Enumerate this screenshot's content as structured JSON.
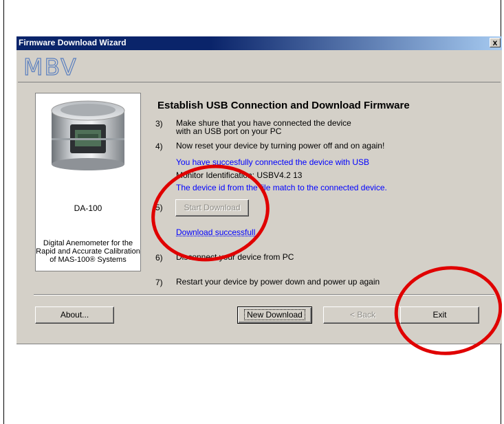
{
  "window": {
    "title": "Firmware Download Wizard",
    "close_label": "x",
    "logo_text": "MBV"
  },
  "device": {
    "name": "DA-100",
    "description": "Digital Anemometer for the Rapid and Accurate Calibration of MAS-100® Systems"
  },
  "heading": "Establish USB Connection and Download Firmware",
  "steps": [
    {
      "num": "3)",
      "line1": "Make shure that you have connected the device",
      "line2": "with an USB port on your PC"
    },
    {
      "num": "4)",
      "line1": "Now reset your device by turning power off and on again!"
    },
    {
      "num": "5)"
    },
    {
      "num": "6)",
      "line1": "Disconnect your device from PC"
    },
    {
      "num": "7)",
      "line1": "Restart your device by power down  and  power up again"
    }
  ],
  "status": {
    "connected": "You have succesfully connected the device with USB",
    "monitor_id": "Monitor Identification: USBV4.2 13",
    "id_match": "The device id from the file match to the connected device.",
    "download_result": "Download successfull"
  },
  "buttons": {
    "start_download": "Start Download",
    "about": "About...",
    "new_download": "New Download",
    "back": "< Back",
    "exit": "Exit"
  },
  "colors": {
    "status_text": "#0000ff",
    "annotation": "#e00000",
    "title_bar": "#0a246a"
  }
}
